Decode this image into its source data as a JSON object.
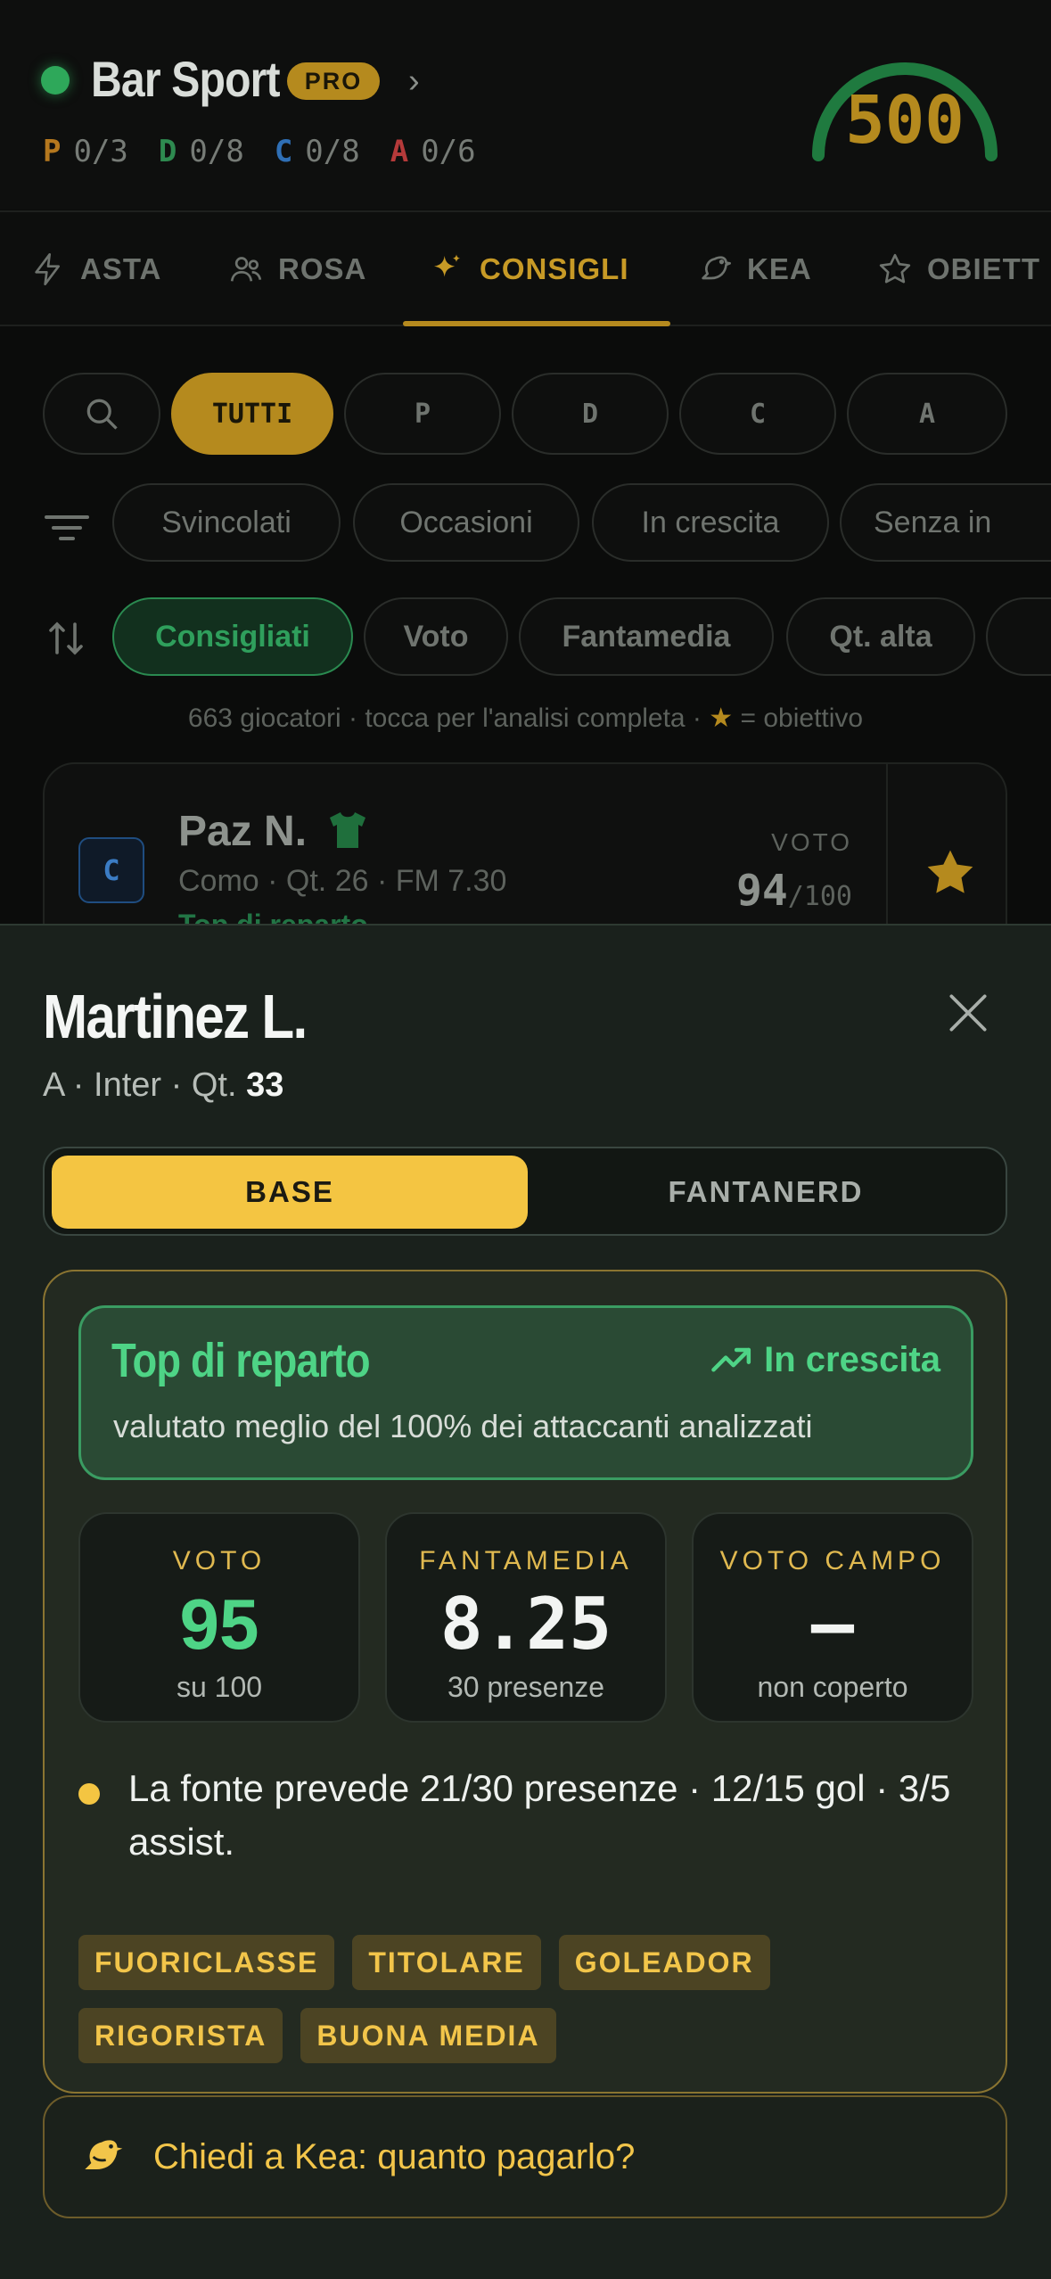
{
  "header": {
    "league": "Bar Sport",
    "badge": "PRO",
    "budget": "500",
    "quotas": [
      {
        "role": "P",
        "value": "0/3",
        "color": "#b5781e"
      },
      {
        "role": "D",
        "value": "0/8",
        "color": "#2e8a50"
      },
      {
        "role": "C",
        "value": "0/8",
        "color": "#2f6fb5"
      },
      {
        "role": "A",
        "value": "0/6",
        "color": "#b53a3a"
      }
    ]
  },
  "tabs": [
    {
      "label": "ASTA",
      "icon": "bolt-icon"
    },
    {
      "label": "ROSA",
      "icon": "users-icon"
    },
    {
      "label": "CONSIGLI",
      "icon": "sparkle-icon",
      "active": true
    },
    {
      "label": "KEA",
      "icon": "bird-icon"
    },
    {
      "label": "OBIETT",
      "icon": "star-icon"
    }
  ],
  "filters": {
    "roles": [
      "TUTTI",
      "P",
      "D",
      "C",
      "A"
    ],
    "categories": [
      "Svincolati",
      "Occasioni",
      "In crescita",
      "Senza in"
    ],
    "sorts": [
      "Consigliati",
      "Voto",
      "Fantamedia",
      "Qt. alta"
    ]
  },
  "hint": {
    "text": "663 giocatori · tocca per l'analisi completa · ",
    "star": "★",
    "suffix": " = obiettivo"
  },
  "player_card": {
    "role": "C",
    "name": "Paz N.",
    "meta": "Como · Qt. 26 · FM 7.30",
    "tag": "Top di reparto",
    "voto_label": "VOTO",
    "voto_value": "94",
    "voto_max": "/100"
  },
  "sheet": {
    "title": "Martinez L.",
    "subtitle": "A · Inter · Qt. ",
    "quotation": "33",
    "segments": {
      "base": "BASE",
      "fantanerd": "FANTANERD"
    },
    "highlight": {
      "title": "Top di reparto",
      "trend": "In crescita",
      "description": "valutato meglio del 100% dei attaccanti analizzati"
    },
    "stats": [
      {
        "label": "VOTO",
        "value": "95",
        "note": "su 100"
      },
      {
        "label": "FANTAMEDIA",
        "value": "8.25",
        "note": "30 presenze"
      },
      {
        "label": "VOTO CAMPO",
        "value": "—",
        "note": "non coperto"
      }
    ],
    "forecast": "La fonte prevede 21/30 presenze · 12/15 gol · 3/5 assist.",
    "tags": [
      "FUORICLASSE",
      "TITOLARE",
      "GOLEADOR",
      "RIGORISTA",
      "BUONA MEDIA"
    ],
    "kea_prompt": "Chiedi a Kea: quanto pagarlo?"
  }
}
